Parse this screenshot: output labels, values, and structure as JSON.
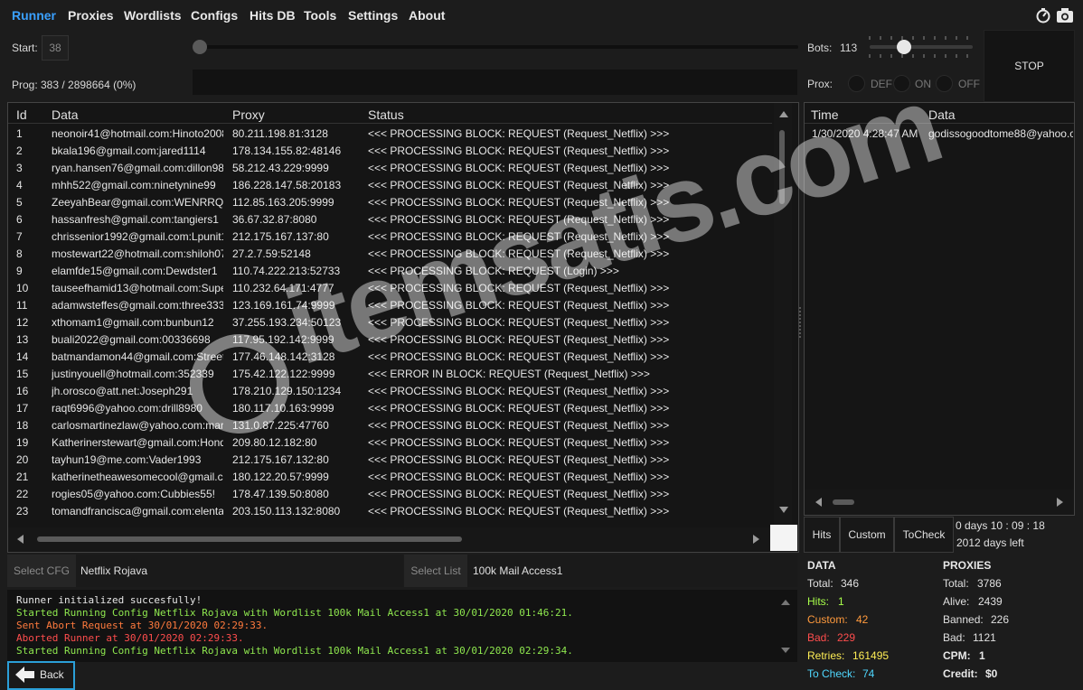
{
  "nav": [
    "Runner",
    "Proxies",
    "Wordlists",
    "Configs",
    "Hits DB",
    "Tools",
    "Settings",
    "About"
  ],
  "controls": {
    "start_label": "Start:",
    "start_value": "38",
    "bots_label": "Bots:",
    "bots_value": "113",
    "prog_label": "Prog:",
    "prog_value": "383 / 2898664 (0%)",
    "prox_label": "Prox:",
    "prox_options": [
      "DEF",
      "ON",
      "OFF"
    ],
    "stop_label": "STOP"
  },
  "grid": {
    "headers": [
      "Id",
      "Data",
      "Proxy",
      "Status"
    ],
    "rows": [
      {
        "id": "1",
        "data": "neonoir41@hotmail.com:Hinoto2008",
        "proxy": "80.211.198.81:3128",
        "status": "<<< PROCESSING BLOCK: REQUEST (Request_Netflix) >>>"
      },
      {
        "id": "2",
        "data": "bkala196@gmail.com:jared1114",
        "proxy": "178.134.155.82:48146",
        "status": "<<< PROCESSING BLOCK: REQUEST (Request_Netflix) >>>"
      },
      {
        "id": "3",
        "data": "ryan.hansen76@gmail.com:dillon98",
        "proxy": "58.212.43.229:9999",
        "status": "<<< PROCESSING BLOCK: REQUEST (Request_Netflix) >>>"
      },
      {
        "id": "4",
        "data": "mhh522@gmail.com:ninetynine99",
        "proxy": "186.228.147.58:20183",
        "status": "<<< PROCESSING BLOCK: REQUEST (Request_Netflix) >>>"
      },
      {
        "id": "5",
        "data": "ZeeyahBear@gmail.com:WENRRQ",
        "proxy": "112.85.163.205:9999",
        "status": "<<< PROCESSING BLOCK: REQUEST (Request_Netflix) >>>"
      },
      {
        "id": "6",
        "data": "hassanfresh@gmail.com:tangiers1",
        "proxy": "36.67.32.87:8080",
        "status": "<<< PROCESSING BLOCK: REQUEST (Request_Netflix) >>>"
      },
      {
        "id": "7",
        "data": "chrissenior1992@gmail.com:Lpunit1",
        "proxy": "212.175.167.137:80",
        "status": "<<< PROCESSING BLOCK: REQUEST (Request_Netflix) >>>"
      },
      {
        "id": "8",
        "data": "mostewart22@hotmail.com:shiloh07",
        "proxy": "27.2.7.59:52148",
        "status": "<<< PROCESSING BLOCK: REQUEST (Request_Netflix) >>>"
      },
      {
        "id": "9",
        "data": "elamfde15@gmail.com:Dewdster1",
        "proxy": "110.74.222.213:52733",
        "status": "<<< PROCESSING BLOCK: REQUEST (Login) >>>"
      },
      {
        "id": "10",
        "data": "tauseefhamid13@hotmail.com:Super",
        "proxy": "110.232.64.171:4777",
        "status": "<<< PROCESSING BLOCK: REQUEST (Request_Netflix) >>>"
      },
      {
        "id": "11",
        "data": "adamwsteffes@gmail.com:three333",
        "proxy": "123.169.161.74:9999",
        "status": "<<< PROCESSING BLOCK: REQUEST (Request_Netflix) >>>"
      },
      {
        "id": "12",
        "data": "xthomam1@gmail.com:bunbun12",
        "proxy": "37.255.193.234:50123",
        "status": "<<< PROCESSING BLOCK: REQUEST (Request_Netflix) >>>"
      },
      {
        "id": "13",
        "data": "buali2022@gmail.com:00336698",
        "proxy": "117.95.192.142:9999",
        "status": "<<< PROCESSING BLOCK: REQUEST (Request_Netflix) >>>"
      },
      {
        "id": "14",
        "data": "batmandamon44@gmail.com:Street",
        "proxy": "177.46.148.142:3128",
        "status": "<<< PROCESSING BLOCK: REQUEST (Request_Netflix) >>>"
      },
      {
        "id": "15",
        "data": "justinyouell@hotmail.com:352339",
        "proxy": "175.42.122.122:9999",
        "status": "<<< ERROR IN BLOCK: REQUEST (Request_Netflix) >>>"
      },
      {
        "id": "16",
        "data": "jh.orosco@att.net:Joseph291",
        "proxy": "178.210.129.150:1234",
        "status": "<<< PROCESSING BLOCK: REQUEST (Request_Netflix) >>>"
      },
      {
        "id": "17",
        "data": "raqt6996@yahoo.com:drill8980",
        "proxy": "180.117.10.163:9999",
        "status": "<<< PROCESSING BLOCK: REQUEST (Request_Netflix) >>>"
      },
      {
        "id": "18",
        "data": "carlosmartinezlaw@yahoo.com:mar",
        "proxy": "131.0.87.225:47760",
        "status": "<<< PROCESSING BLOCK: REQUEST (Request_Netflix) >>>"
      },
      {
        "id": "19",
        "data": "Katherinerstewart@gmail.com:Hond",
        "proxy": "209.80.12.182:80",
        "status": "<<< PROCESSING BLOCK: REQUEST (Request_Netflix) >>>"
      },
      {
        "id": "20",
        "data": "tayhun19@me.com:Vader1993",
        "proxy": "212.175.167.132:80",
        "status": "<<< PROCESSING BLOCK: REQUEST (Request_Netflix) >>>"
      },
      {
        "id": "21",
        "data": "katherinetheawesomecool@gmail.c",
        "proxy": "180.122.20.57:9999",
        "status": "<<< PROCESSING BLOCK: REQUEST (Request_Netflix) >>>"
      },
      {
        "id": "22",
        "data": "rogies05@yahoo.com:Cubbies55!",
        "proxy": "178.47.139.50:8080",
        "status": "<<< PROCESSING BLOCK: REQUEST (Request_Netflix) >>>"
      },
      {
        "id": "23",
        "data": "tomandfrancisca@gmail.com:elenta",
        "proxy": "203.150.113.132:8080",
        "status": "<<< PROCESSING BLOCK: REQUEST (Request_Netflix) >>>"
      }
    ]
  },
  "hits_log": {
    "headers": [
      "Time",
      "Data"
    ],
    "rows": [
      {
        "time": "1/30/2020 4:28:47 AM",
        "data": "godissogoodtome88@yahoo.co"
      }
    ]
  },
  "right_tabs": [
    "Hits",
    "Custom",
    "ToCheck"
  ],
  "elapsed": "0  days  10 : 09 : 18",
  "days_left": "2012 days left",
  "cfg": {
    "select_cfg_label": "Select CFG",
    "cfg_value": "Netflix Rojava",
    "select_list_label": "Select List",
    "list_value": "100k Mail Access1"
  },
  "console": [
    {
      "text": "Runner initialized succesfully!",
      "color": "#e6e6e6"
    },
    {
      "text": "Started Running Config Netflix Rojava with Wordlist 100k Mail Access1 at 30/01/2020 01:46:21.",
      "color": "#8fe84f"
    },
    {
      "text": "Sent Abort Request at 30/01/2020 02:29:33.",
      "color": "#ff7a3d"
    },
    {
      "text": "Aborted Runner at 30/01/2020 02:29:33.",
      "color": "#ff4d4d"
    },
    {
      "text": "Started Running Config Netflix Rojava with Wordlist 100k Mail Access1 at 30/01/2020 02:29:34.",
      "color": "#8fe84f"
    }
  ],
  "back_label": "Back",
  "stats": {
    "data_title": "DATA",
    "data": [
      {
        "label": "Total:",
        "value": "346",
        "color": "#e0e0e0"
      },
      {
        "label": "Hits:",
        "value": "1",
        "color": "#a8ff4a"
      },
      {
        "label": "Custom:",
        "value": "42",
        "color": "#ff9a3d"
      },
      {
        "label": "Bad:",
        "value": "229",
        "color": "#ff4d4d"
      },
      {
        "label": "Retries:",
        "value": "161495",
        "color": "#ffee55"
      },
      {
        "label": "To Check:",
        "value": "74",
        "color": "#4fd8ff"
      }
    ],
    "proxies_title": "PROXIES",
    "proxies": [
      {
        "label": "Total:",
        "value": "3786"
      },
      {
        "label": "Alive:",
        "value": "2439"
      },
      {
        "label": "Banned:",
        "value": "226"
      },
      {
        "label": "Bad:",
        "value": "1121"
      }
    ],
    "cpm_label": "CPM:",
    "cpm_value": "1",
    "credit_label": "Credit:",
    "credit_value": "$0"
  },
  "watermark": "itemsatis.com"
}
